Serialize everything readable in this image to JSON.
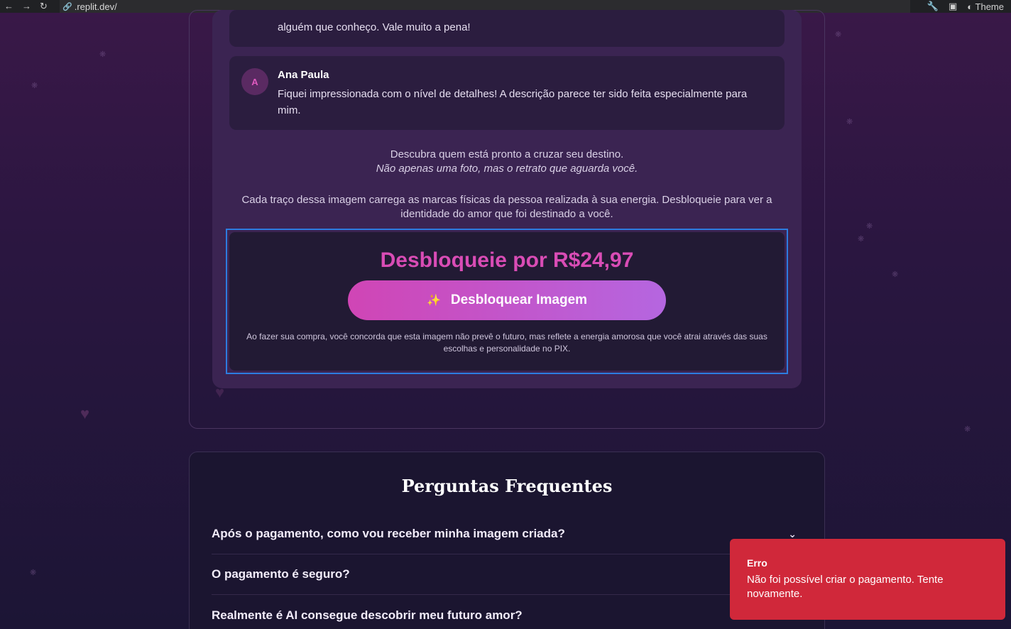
{
  "browser": {
    "url": ".replit.dev/",
    "back_icon": "back-arrow-icon",
    "forward_icon": "forward-arrow-icon",
    "reload_icon": "reload-icon",
    "theme_label": "Theme"
  },
  "testimonials": [
    {
      "text": "alguém que conheço. Vale muito a pena!"
    },
    {
      "avatar": "A",
      "name": "Ana Paula",
      "text": "Fiquei impressionada com o nível de detalhes! A descrição parece ter sido feita especialmente para mim."
    }
  ],
  "description": {
    "line1": "Descubra quem está pronto a cruzar seu destino.",
    "line2": "Não apenas uma foto, mas o retrato que aguarda você.",
    "paragraph": "Cada traço dessa imagem carrega as marcas físicas da pessoa realizada à sua energia. Desbloqueie para ver a identidade do amor que foi destinado a você."
  },
  "unlock": {
    "price_label": "Desbloqueie por R$24,97",
    "button_label": "Desbloquear Imagem",
    "terms": "Ao fazer sua compra, você concorda que esta imagem não prevê o futuro, mas reflete a energia amorosa que você atrai através das suas escolhas e personalidade no PIX."
  },
  "faq": {
    "title": "Perguntas Frequentes",
    "items": [
      {
        "question": "Após o pagamento, como vou receber minha imagem criada?"
      },
      {
        "question": "O pagamento é seguro?"
      },
      {
        "question": "Realmente é AI consegue descobrir meu futuro amor?"
      }
    ]
  },
  "toast": {
    "title": "Erro",
    "message": "Não foi possível criar o pagamento. Tente novamente.",
    "color": "#d0283a"
  },
  "colors": {
    "accent": "#d94cb5",
    "button_gradient_start": "#d045b5",
    "button_gradient_end": "#b566e0"
  }
}
